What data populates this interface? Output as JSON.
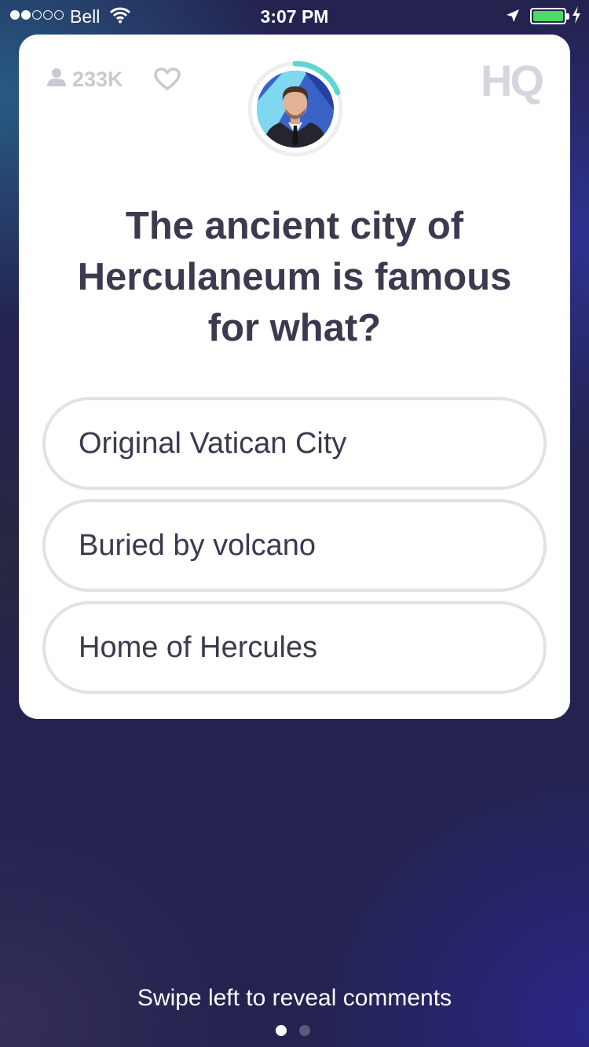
{
  "status_bar": {
    "carrier": "Bell",
    "time": "3:07 PM",
    "signal_bars_on": 2,
    "signal_bars_total": 5,
    "battery_color": "#4cd964"
  },
  "header": {
    "viewer_count": "233K",
    "logo": "HQ"
  },
  "question": {
    "text": "The ancient city of Herculaneum is famous for what?"
  },
  "answers": [
    {
      "label": "Original Vatican City"
    },
    {
      "label": "Buried by volcano"
    },
    {
      "label": "Home of Hercules"
    }
  ],
  "footer": {
    "hint": "Swipe left to reveal comments",
    "page_count": 2,
    "active_page": 1
  },
  "colors": {
    "timer_ring": "#5fd6d0",
    "text_dark": "#3b3a4f"
  }
}
